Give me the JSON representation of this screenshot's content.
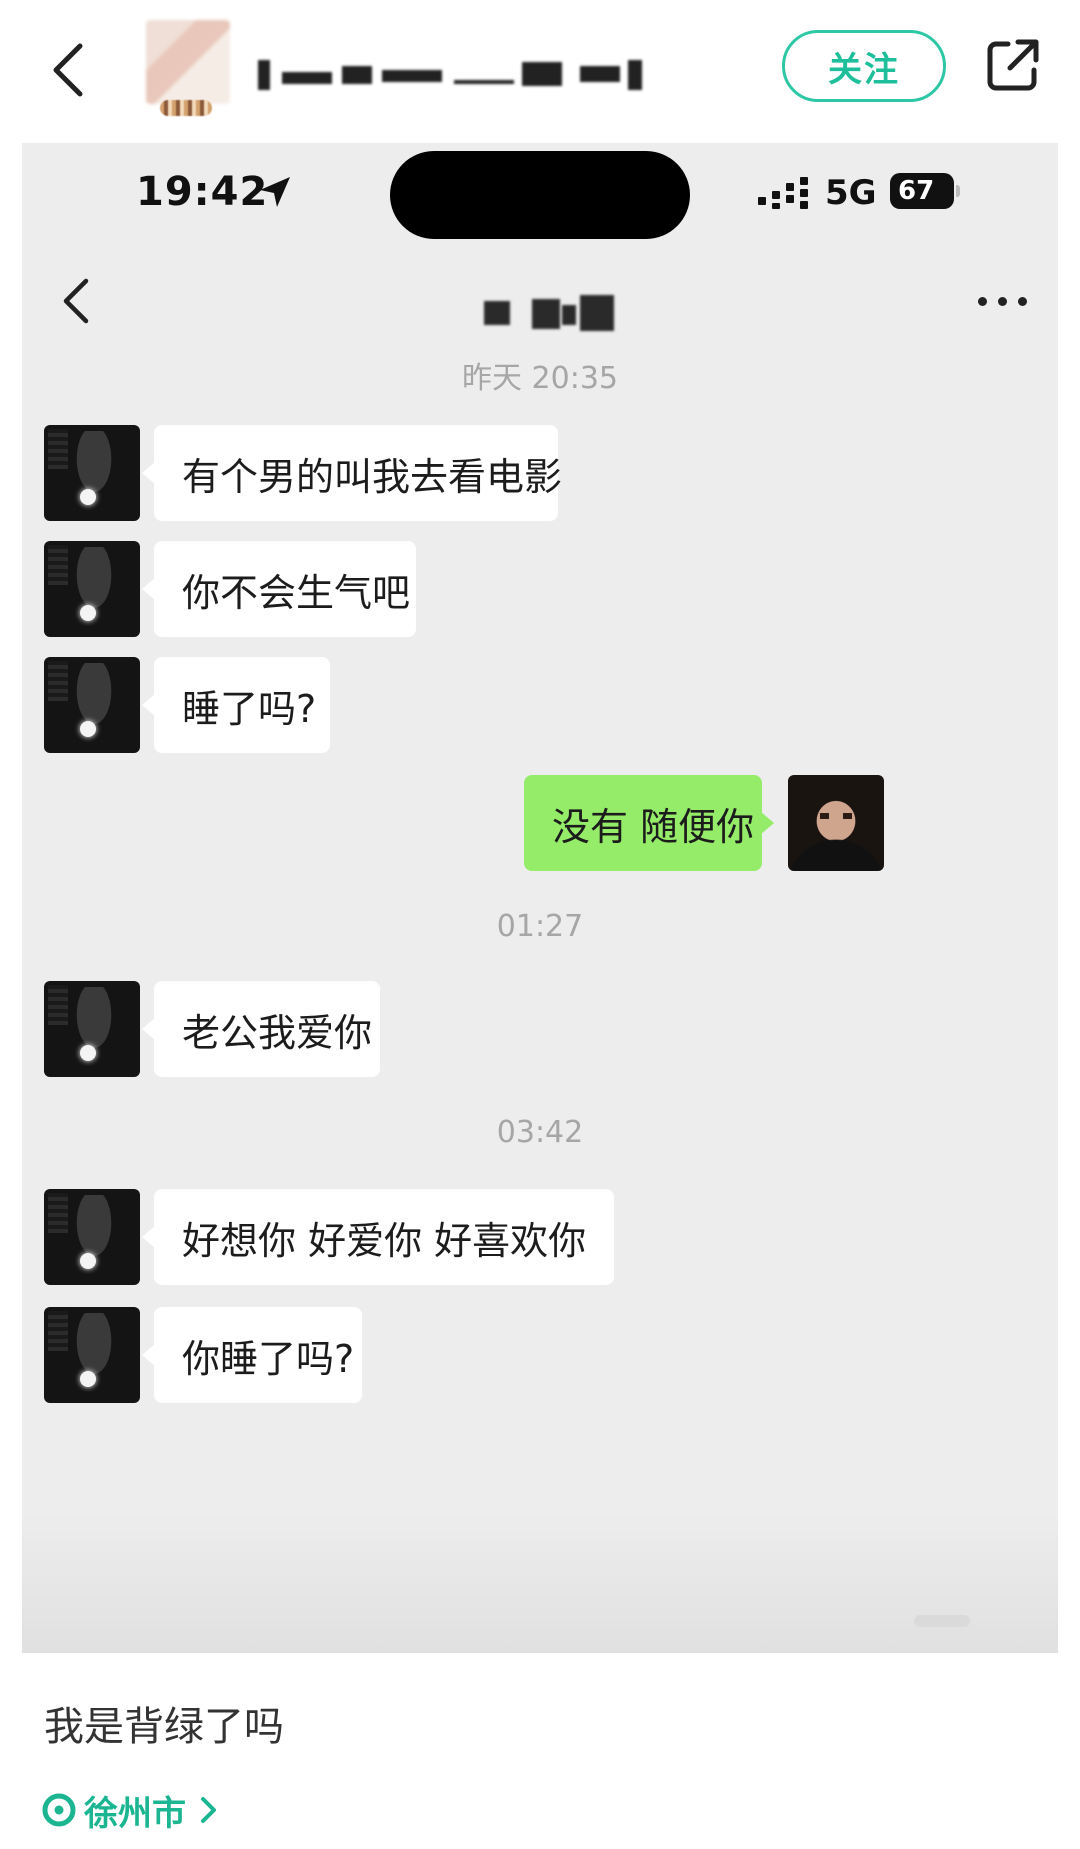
{
  "header": {
    "follow_label": "关注"
  },
  "screenshot": {
    "status_bar": {
      "time": "19:42",
      "network": "5G",
      "battery": "67"
    },
    "messages": [
      {
        "type": "timestamp",
        "text": "昨天 20:35"
      },
      {
        "type": "incoming",
        "text": "有个男的叫我去看电影"
      },
      {
        "type": "incoming",
        "text": "你不会生气吧"
      },
      {
        "type": "incoming",
        "text": "睡了吗?"
      },
      {
        "type": "outgoing",
        "text": "没有 随便你"
      },
      {
        "type": "timestamp",
        "text": "01:27"
      },
      {
        "type": "incoming",
        "text": "老公我爱你"
      },
      {
        "type": "timestamp",
        "text": "03:42"
      },
      {
        "type": "incoming",
        "text": "好想你 好爱你 好喜欢你",
        "emoji": "heart-icon"
      },
      {
        "type": "incoming",
        "text": "你睡了吗?"
      }
    ]
  },
  "post": {
    "text": "我是背绿了吗",
    "location": "徐州市"
  },
  "colors": {
    "accent": "#1fbf9b",
    "outgoing_bubble": "#95ec69",
    "chat_background": "#ededed"
  }
}
